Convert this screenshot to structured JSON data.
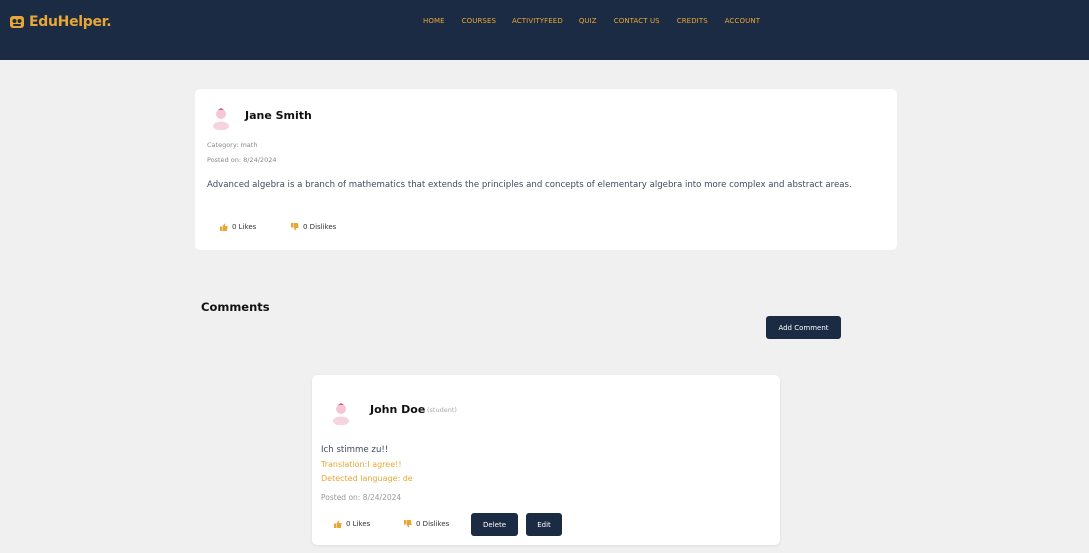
{
  "brand": {
    "name": "EduHelper.",
    "accent": "#e8a735",
    "icon": "graduation-badge-icon"
  },
  "nav": {
    "items": [
      "HOME",
      "COURSES",
      "ACTIVITYFEED",
      "QUIZ",
      "CONTACT US",
      "CREDITS",
      "ACCOUNT"
    ]
  },
  "post": {
    "author": "Jane Smith",
    "avatar_icon": "user-avatar-icon",
    "category": "Category: math",
    "posted_on": "Posted on: 8/24/2024",
    "body": "Advanced algebra is a branch of mathematics that extends the principles and concepts of elementary algebra into more complex and abstract areas.",
    "likes": "0 Likes",
    "dislikes": "0 Dislikes"
  },
  "comments": {
    "title": "Comments",
    "add_label": "Add Comment",
    "items": [
      {
        "author": "John Doe",
        "role": "(student)",
        "text": "Ich stimme zu!!",
        "translation": "Translation:I agree!!",
        "detected": "Detected language: de",
        "posted_on": "Posted on: 8/24/2024",
        "likes": "0 Likes",
        "dislikes": "0 Dislikes",
        "delete_label": "Delete",
        "edit_label": "Edit"
      }
    ]
  },
  "colors": {
    "navy": "#1c2b44",
    "accent": "#e8a735",
    "background": "#f0f0f0"
  }
}
